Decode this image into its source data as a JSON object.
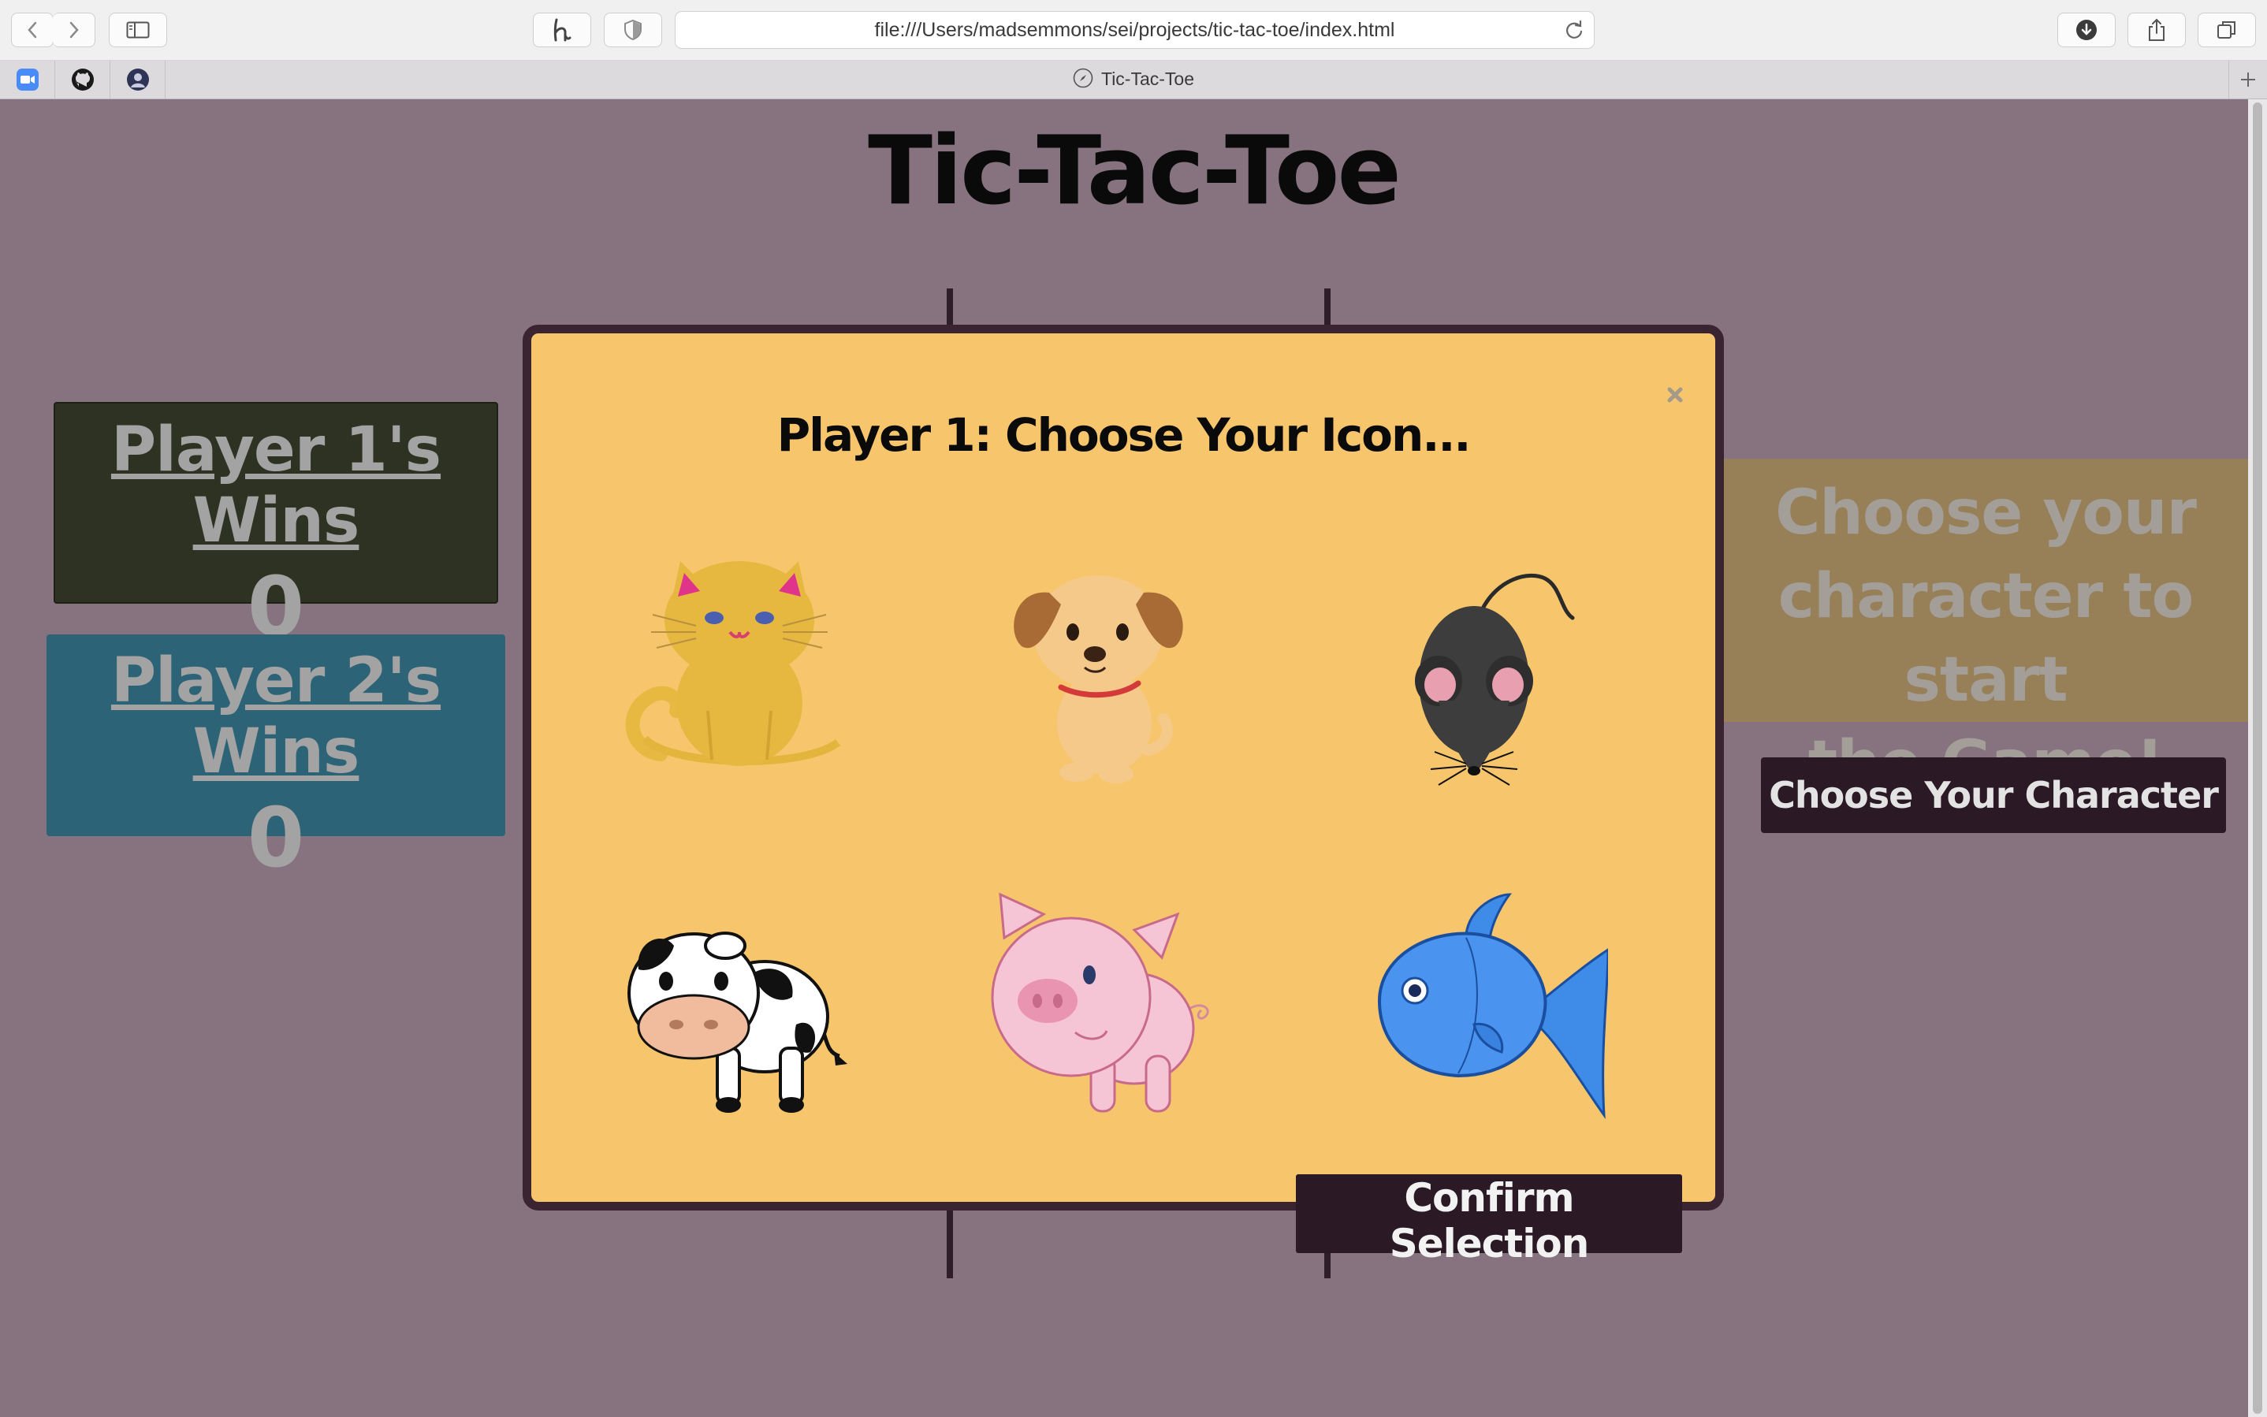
{
  "browser": {
    "url": "file:///Users/madsemmons/sei/projects/tic-tac-toe/index.html",
    "tab_title": "Tic-Tac-Toe",
    "pinned_tabs": [
      "zoom-icon",
      "github-icon",
      "profile-icon"
    ]
  },
  "page": {
    "title": "Tic-Tac-Toe",
    "player1": {
      "label": "Player 1's Wins",
      "score": "0"
    },
    "player2": {
      "label": "Player 2's Wins",
      "score": "0"
    },
    "status_lines": [
      "Choose your",
      "character to start",
      "the Game!"
    ],
    "choose_button": "Choose Your Character"
  },
  "modal": {
    "title": "Player 1: Choose Your Icon...",
    "close_label": "×",
    "icons": [
      "cat",
      "dog",
      "mouse",
      "cow",
      "pig",
      "fish"
    ],
    "confirm_button": "Confirm Selection"
  },
  "colors": {
    "background": "#86737f",
    "modal": "#f7c66c",
    "dark_button": "#2b1a26",
    "player1_card": "#2d3222",
    "player2_card": "#2c6376",
    "status_box": "#978058"
  }
}
